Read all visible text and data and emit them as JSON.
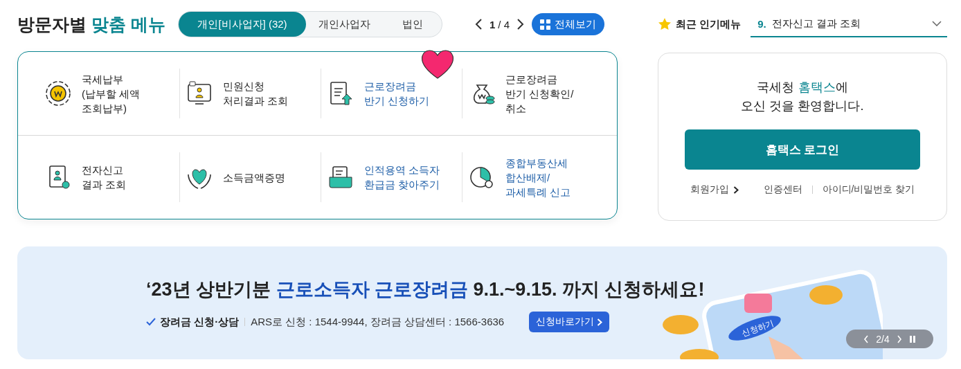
{
  "header": {
    "title": "방문자별",
    "title_accent": "맞춤 메뉴"
  },
  "tabs": [
    {
      "label": "개인[비사업자] (32)",
      "selected": true
    },
    {
      "label": "개인사업자",
      "selected": false
    },
    {
      "label": "법인",
      "selected": false
    }
  ],
  "pager": {
    "current": "1",
    "total": "/ 4"
  },
  "view_all": "전체보기",
  "popular": {
    "label": "최근 인기메뉴",
    "number": "9.",
    "value": "전자신고 결과 조회"
  },
  "menu_rows": [
    [
      {
        "kind": "coin",
        "lines": [
          "국세납부",
          "(납부할 세액",
          "조회납부)"
        ],
        "highlight": false,
        "favorite": false
      },
      {
        "kind": "monitor",
        "lines": [
          "민원신청",
          "처리결과 조회"
        ],
        "highlight": false,
        "favorite": false
      },
      {
        "kind": "upload",
        "lines": [
          "근로장려금",
          "반기 신청하기"
        ],
        "highlight": true,
        "favorite": true
      },
      {
        "kind": "bag",
        "lines": [
          "근로장려금",
          "반기 신청확인/",
          "취소"
        ],
        "highlight": false,
        "favorite": false
      }
    ],
    [
      {
        "kind": "certificate",
        "lines": [
          "전자신고",
          "결과 조회"
        ],
        "highlight": false,
        "favorite": false
      },
      {
        "kind": "heart",
        "lines": [
          "소득금액증명"
        ],
        "highlight": false,
        "favorite": false
      },
      {
        "kind": "folder",
        "lines": [
          "인적용역 소득자",
          "환급금 찾아주기"
        ],
        "highlight": true,
        "favorite": false
      },
      {
        "kind": "chart",
        "lines": [
          "종합부동산세",
          "합산배제/",
          "과세특례 신고"
        ],
        "highlight": true,
        "favorite": false
      }
    ]
  ],
  "login": {
    "welcome_start": "국세청 ",
    "welcome_accent": "홈택스",
    "welcome_end": "에",
    "welcome_line2": "오신 것을 환영합니다.",
    "button": "홈택스 로그인",
    "links": [
      {
        "label": "회원가입",
        "kind": "arrow"
      },
      {
        "label": "인증센터",
        "kind": "plain"
      },
      {
        "label": "아이디/비밀번호 찾기",
        "kind": "plain"
      }
    ]
  },
  "banner": {
    "headline_start": "‘23년 상반기분 ",
    "headline_accent": "근로소득자 근로장려금",
    "headline_end": " 9.1.~9.15. 까지 신청하세요!",
    "check_label": "장려금 신청·상담",
    "info": "ARS로 신청 : 1544-9944, 장려금 상담센터 : 1566-3636",
    "button": "신청바로가기",
    "illustration_label": "신청하기",
    "slide": "2/4"
  }
}
